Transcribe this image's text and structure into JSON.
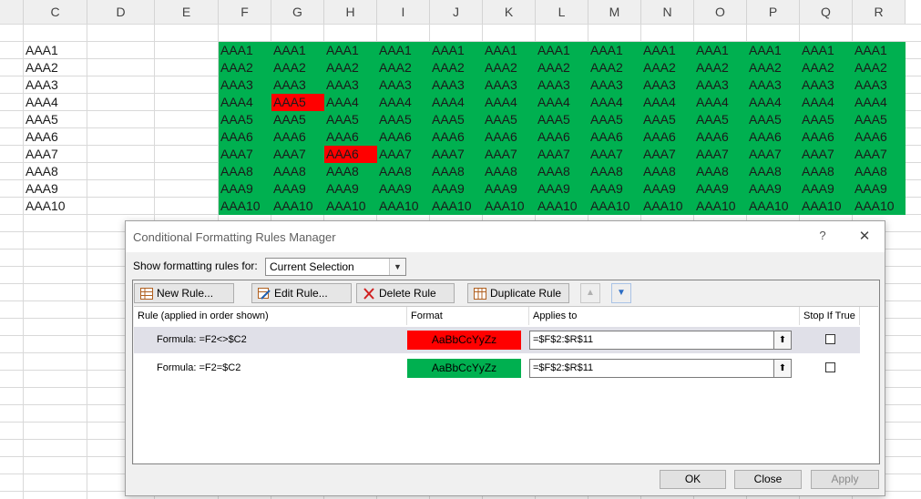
{
  "columns": [
    "C",
    "D",
    "E",
    "F",
    "G",
    "H",
    "I",
    "J",
    "K",
    "L",
    "M",
    "N",
    "O",
    "P",
    "Q",
    "R"
  ],
  "col_c_values": [
    "AAA1",
    "AAA2",
    "AAA3",
    "AAA4",
    "AAA5",
    "AAA6",
    "AAA7",
    "AAA8",
    "AAA9",
    "AAA10"
  ],
  "grid_rows": [
    [
      "AAA1",
      "AAA1",
      "AAA1",
      "AAA1",
      "AAA1",
      "AAA1",
      "AAA1",
      "AAA1",
      "AAA1",
      "AAA1",
      "AAA1",
      "AAA1",
      "AAA1"
    ],
    [
      "AAA2",
      "AAA2",
      "AAA2",
      "AAA2",
      "AAA2",
      "AAA2",
      "AAA2",
      "AAA2",
      "AAA2",
      "AAA2",
      "AAA2",
      "AAA2",
      "AAA2"
    ],
    [
      "AAA3",
      "AAA3",
      "AAA3",
      "AAA3",
      "AAA3",
      "AAA3",
      "AAA3",
      "AAA3",
      "AAA3",
      "AAA3",
      "AAA3",
      "AAA3",
      "AAA3"
    ],
    [
      "AAA4",
      "AAA5",
      "AAA4",
      "AAA4",
      "AAA4",
      "AAA4",
      "AAA4",
      "AAA4",
      "AAA4",
      "AAA4",
      "AAA4",
      "AAA4",
      "AAA4"
    ],
    [
      "AAA5",
      "AAA5",
      "AAA5",
      "AAA5",
      "AAA5",
      "AAA5",
      "AAA5",
      "AAA5",
      "AAA5",
      "AAA5",
      "AAA5",
      "AAA5",
      "AAA5"
    ],
    [
      "AAA6",
      "AAA6",
      "AAA6",
      "AAA6",
      "AAA6",
      "AAA6",
      "AAA6",
      "AAA6",
      "AAA6",
      "AAA6",
      "AAA6",
      "AAA6",
      "AAA6"
    ],
    [
      "AAA7",
      "AAA7",
      "AAA6",
      "AAA7",
      "AAA7",
      "AAA7",
      "AAA7",
      "AAA7",
      "AAA7",
      "AAA7",
      "AAA7",
      "AAA7",
      "AAA7"
    ],
    [
      "AAA8",
      "AAA8",
      "AAA8",
      "AAA8",
      "AAA8",
      "AAA8",
      "AAA8",
      "AAA8",
      "AAA8",
      "AAA8",
      "AAA8",
      "AAA8",
      "AAA8"
    ],
    [
      "AAA9",
      "AAA9",
      "AAA9",
      "AAA9",
      "AAA9",
      "AAA9",
      "AAA9",
      "AAA9",
      "AAA9",
      "AAA9",
      "AAA9",
      "AAA9",
      "AAA9"
    ],
    [
      "AAA10",
      "AAA10",
      "AAA10",
      "AAA10",
      "AAA10",
      "AAA10",
      "AAA10",
      "AAA10",
      "AAA10",
      "AAA10",
      "AAA10",
      "AAA10",
      "AAA10"
    ]
  ],
  "highlighted_cells": [
    {
      "row": 3,
      "col": 1
    },
    {
      "row": 6,
      "col": 2
    }
  ],
  "colors": {
    "green_fill": "#00b050",
    "red_fill": "#ff0000"
  },
  "dialog": {
    "title": "Conditional Formatting Rules Manager",
    "help": "?",
    "close": "✕",
    "show_label": "Show formatting rules for:",
    "scope_value": "Current Selection",
    "toolbar": {
      "new_rule": "New Rule...",
      "edit_rule": "Edit Rule...",
      "delete_rule": "Delete Rule",
      "duplicate_rule": "Duplicate Rule",
      "move_up": "▲",
      "move_down": "▼"
    },
    "headers": {
      "rule": "Rule (applied in order shown)",
      "format": "Format",
      "applies_to": "Applies to",
      "stop_if_true": "Stop If True"
    },
    "rules": [
      {
        "formula": "Formula: =F2<>$C2",
        "preview": "AaBbCcYyZz",
        "applies_to": "=$F$2:$R$11",
        "fill": "#ff0000"
      },
      {
        "formula": "Formula: =F2=$C2",
        "preview": "AaBbCcYyZz",
        "applies_to": "=$F$2:$R$11",
        "fill": "#00b050"
      }
    ],
    "buttons": {
      "ok": "OK",
      "close": "Close",
      "apply": "Apply"
    }
  }
}
